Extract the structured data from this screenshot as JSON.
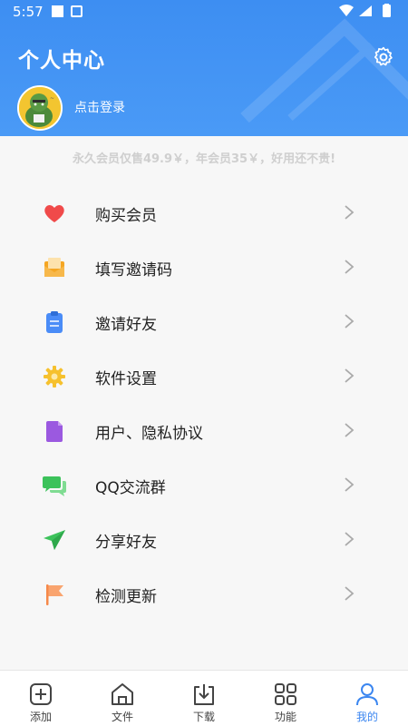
{
  "status_bar": {
    "time": "5:57"
  },
  "header": {
    "title": "个人中心",
    "login_text": "点击登录"
  },
  "promo_text": "永久会员仅售49.9￥，年会员35￥，好用还不贵!",
  "menu": [
    {
      "label": "购买会员",
      "icon": "heart-icon",
      "color": "#f04a4a"
    },
    {
      "label": "填写邀请码",
      "icon": "envelope-icon",
      "color": "#f5a623"
    },
    {
      "label": "邀请好友",
      "icon": "clipboard-icon",
      "color": "#4a8cf7"
    },
    {
      "label": "软件设置",
      "icon": "gear-icon",
      "color": "#f6c12e"
    },
    {
      "label": "用户、隐私协议",
      "icon": "document-icon",
      "color": "#9b59e0"
    },
    {
      "label": "QQ交流群",
      "icon": "chat-icon",
      "color": "#3cc25b"
    },
    {
      "label": "分享好友",
      "icon": "send-icon",
      "color": "#3cc25b"
    },
    {
      "label": "检测更新",
      "icon": "flag-icon",
      "color": "#f6894a"
    }
  ],
  "bottom_nav": [
    {
      "label": "添加",
      "icon": "add-icon",
      "active": false
    },
    {
      "label": "文件",
      "icon": "home-icon",
      "active": false
    },
    {
      "label": "下载",
      "icon": "download-icon",
      "active": false
    },
    {
      "label": "功能",
      "icon": "grid-icon",
      "active": false
    },
    {
      "label": "我的",
      "icon": "user-icon",
      "active": true
    }
  ],
  "colors": {
    "header": "#4a9af6",
    "accent": "#3b86f0",
    "background": "#f7f7f7"
  }
}
